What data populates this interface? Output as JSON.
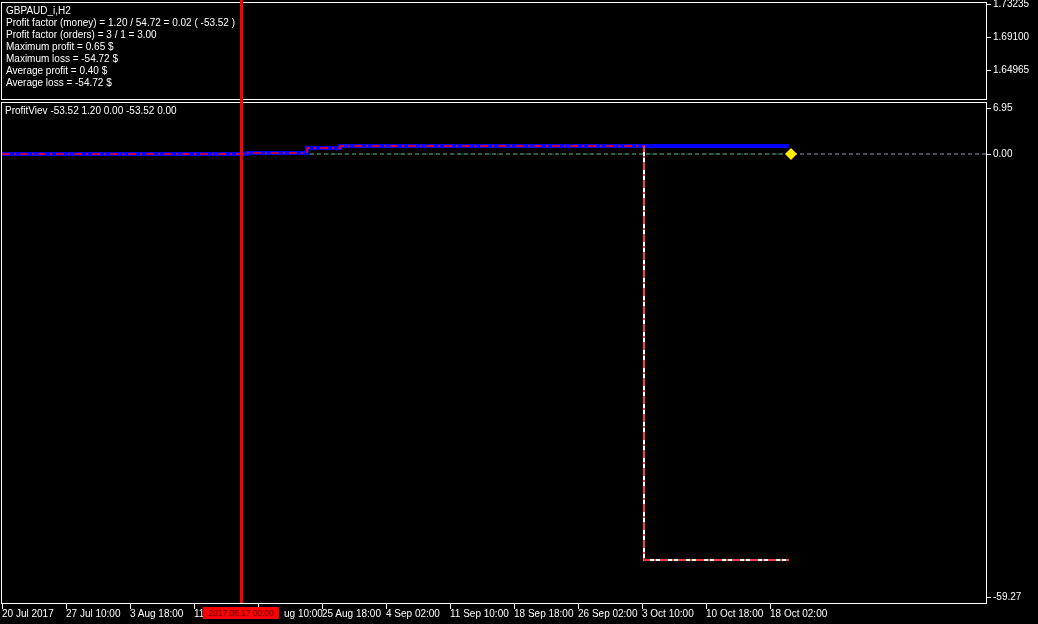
{
  "top_pane": {
    "title": "GBPAUD_i,H2",
    "stats": [
      "Profit factor (money) = 1.20 / 54.72 = 0.02 ( -53.52 )",
      "Profit factor  (orders) = 3 / 1 = 3.00",
      "Maximum profit = 0.65 $",
      "Maximum loss = -54.72 $",
      "Average profit = 0.40 $",
      "Average loss = -54.72 $"
    ]
  },
  "top_price_axis": [
    "1.73235",
    "1.69100",
    "1.64965"
  ],
  "indicator_pane": {
    "label": "ProfitViev -53.52 1.20 0.00 -53.52 0.00"
  },
  "indicator_axis": [
    "6.95",
    "0.00",
    "-59.27"
  ],
  "time_axis": [
    "20 Jul 2017",
    "27 Jul 10:00",
    "3 Aug 18:00",
    "11",
    "ug 10:00",
    "25 Aug 18:00",
    "4 Sep 02:00",
    "11 Sep 10:00",
    "18 Sep 18:00",
    "26 Sep 02:00",
    "3 Oct 10:00",
    "10 Oct 18:00",
    "18 Oct 02:00"
  ],
  "cursor_time": "2017.08.17 00:00"
}
